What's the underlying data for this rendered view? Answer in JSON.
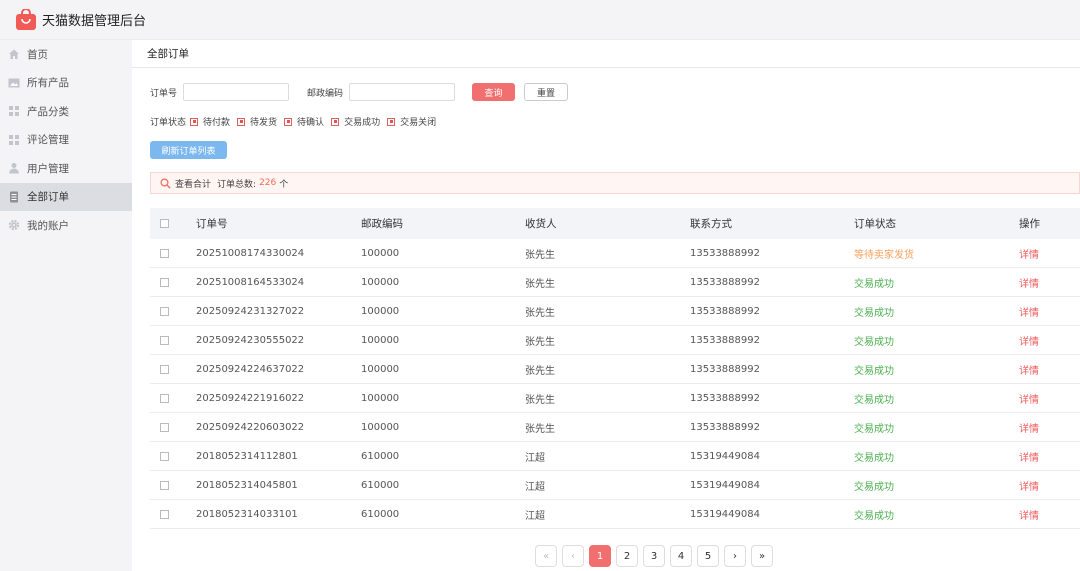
{
  "app": {
    "title": "天猫数据管理后台"
  },
  "sidebar": {
    "items": [
      {
        "label": "首页",
        "icon": "home-icon"
      },
      {
        "label": "所有产品",
        "icon": "image-icon"
      },
      {
        "label": "产品分类",
        "icon": "grid-icon"
      },
      {
        "label": "评论管理",
        "icon": "grid-icon"
      },
      {
        "label": "用户管理",
        "icon": "user-icon"
      },
      {
        "label": "全部订单",
        "icon": "document-icon",
        "active": true
      },
      {
        "label": "我的账户",
        "icon": "gear-icon"
      }
    ]
  },
  "page": {
    "title": "全部订单"
  },
  "filters": {
    "order_no_label": "订单号",
    "order_no_value": "",
    "zip_label": "邮政编码",
    "zip_value": "",
    "search_label": "查询",
    "reset_label": "重置"
  },
  "status_filter": {
    "label": "订单状态",
    "options": [
      "待付款",
      "待发货",
      "待确认",
      "交易成功",
      "交易关闭"
    ]
  },
  "refresh_label": "刷新订单列表",
  "summary": {
    "prefix": "查看合计",
    "count_label": "订单总数:",
    "count": "226",
    "unit": "个"
  },
  "table": {
    "headers": [
      "订单号",
      "邮政编码",
      "收货人",
      "联系方式",
      "订单状态",
      "操作"
    ],
    "rows": [
      {
        "order_no": "20251008174330024",
        "zip": "100000",
        "receiver": "张先生",
        "phone": "13533888992",
        "status": "等待卖家发货",
        "status_type": "wait",
        "action": "详情"
      },
      {
        "order_no": "20251008164533024",
        "zip": "100000",
        "receiver": "张先生",
        "phone": "13533888992",
        "status": "交易成功",
        "status_type": "ok",
        "action": "详情"
      },
      {
        "order_no": "20250924231327022",
        "zip": "100000",
        "receiver": "张先生",
        "phone": "13533888992",
        "status": "交易成功",
        "status_type": "ok",
        "action": "详情"
      },
      {
        "order_no": "20250924230555022",
        "zip": "100000",
        "receiver": "张先生",
        "phone": "13533888992",
        "status": "交易成功",
        "status_type": "ok",
        "action": "详情"
      },
      {
        "order_no": "20250924224637022",
        "zip": "100000",
        "receiver": "张先生",
        "phone": "13533888992",
        "status": "交易成功",
        "status_type": "ok",
        "action": "详情"
      },
      {
        "order_no": "20250924221916022",
        "zip": "100000",
        "receiver": "张先生",
        "phone": "13533888992",
        "status": "交易成功",
        "status_type": "ok",
        "action": "详情"
      },
      {
        "order_no": "20250924220603022",
        "zip": "100000",
        "receiver": "张先生",
        "phone": "13533888992",
        "status": "交易成功",
        "status_type": "ok",
        "action": "详情"
      },
      {
        "order_no": "2018052314112801",
        "zip": "610000",
        "receiver": "江超",
        "phone": "15319449084",
        "status": "交易成功",
        "status_type": "ok",
        "action": "详情"
      },
      {
        "order_no": "2018052314045801",
        "zip": "610000",
        "receiver": "江超",
        "phone": "15319449084",
        "status": "交易成功",
        "status_type": "ok",
        "action": "详情"
      },
      {
        "order_no": "2018052314033101",
        "zip": "610000",
        "receiver": "江超",
        "phone": "15319449084",
        "status": "交易成功",
        "status_type": "ok",
        "action": "详情"
      }
    ]
  },
  "pagination": {
    "first": "«",
    "prev": "‹",
    "pages": [
      "1",
      "2",
      "3",
      "4",
      "5"
    ],
    "current": "1",
    "next": "›",
    "last": "»"
  },
  "colors": {
    "accent": "#f26f6f",
    "refresh_button": "#7cb8f0",
    "status_wait": "#f4a25f",
    "status_ok": "#4caf50",
    "detail_link": "#ef5a5a"
  }
}
